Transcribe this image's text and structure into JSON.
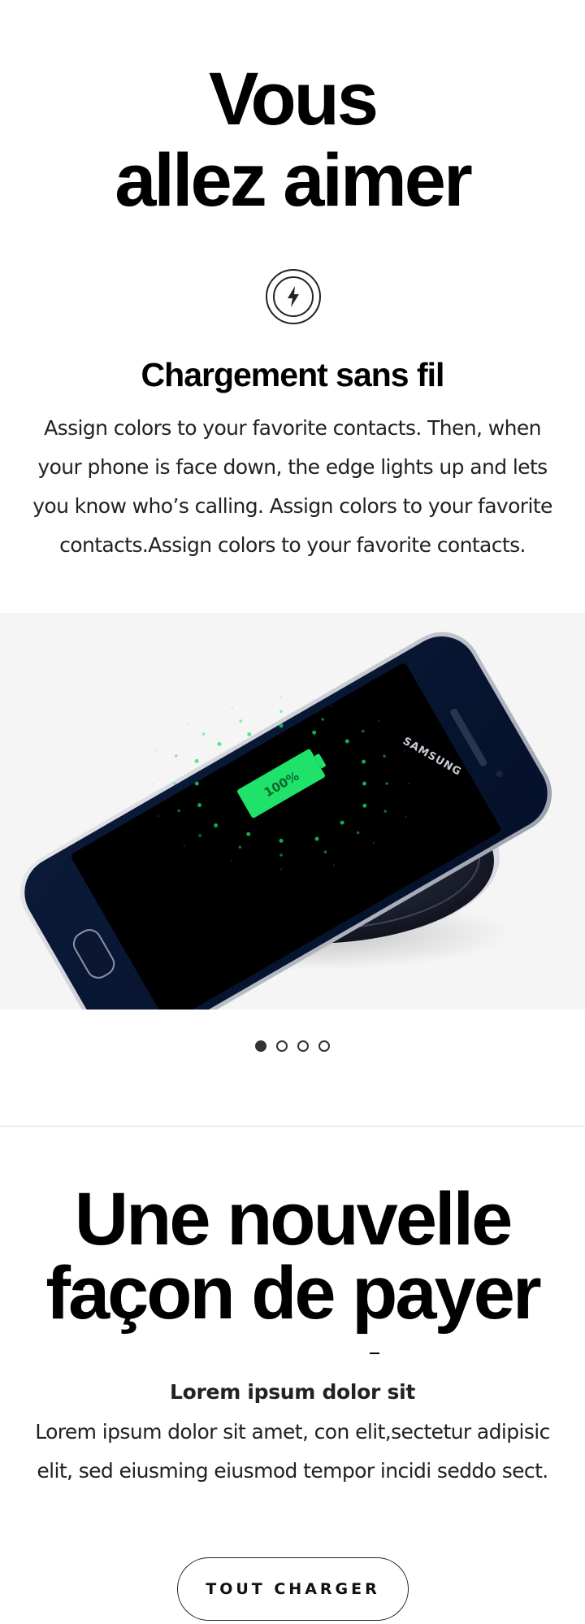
{
  "hero": {
    "line1": "Vous",
    "line2": "allez aimer"
  },
  "feature": {
    "icon": "lightning-charge-icon",
    "title": "Chargement sans fil",
    "description": "Assign colors to your favorite contacts. Then, when your phone is face down, the edge lights up and lets you know who’s calling. Assign colors to your favorite contacts.Assign colors to your favorite contacts."
  },
  "carousel": {
    "battery_label": "100%",
    "brand_label": "SAMSUNG",
    "slide_count": 4,
    "active_index": 0
  },
  "payment": {
    "line1": "Une nouvelle",
    "line2": "façon de payer",
    "subtitle": "Lorem ipsum dolor sit",
    "description": "Lorem ipsum dolor sit amet, con elit,sectetur adipisic elit, sed eiusming  eiusmod tempor incidi seddo sect."
  },
  "cta": {
    "label": "TOUT CHARGER"
  },
  "colors": {
    "charge_green": "#1fe26a",
    "background_gray": "#f5f5f5",
    "text": "#000000"
  }
}
